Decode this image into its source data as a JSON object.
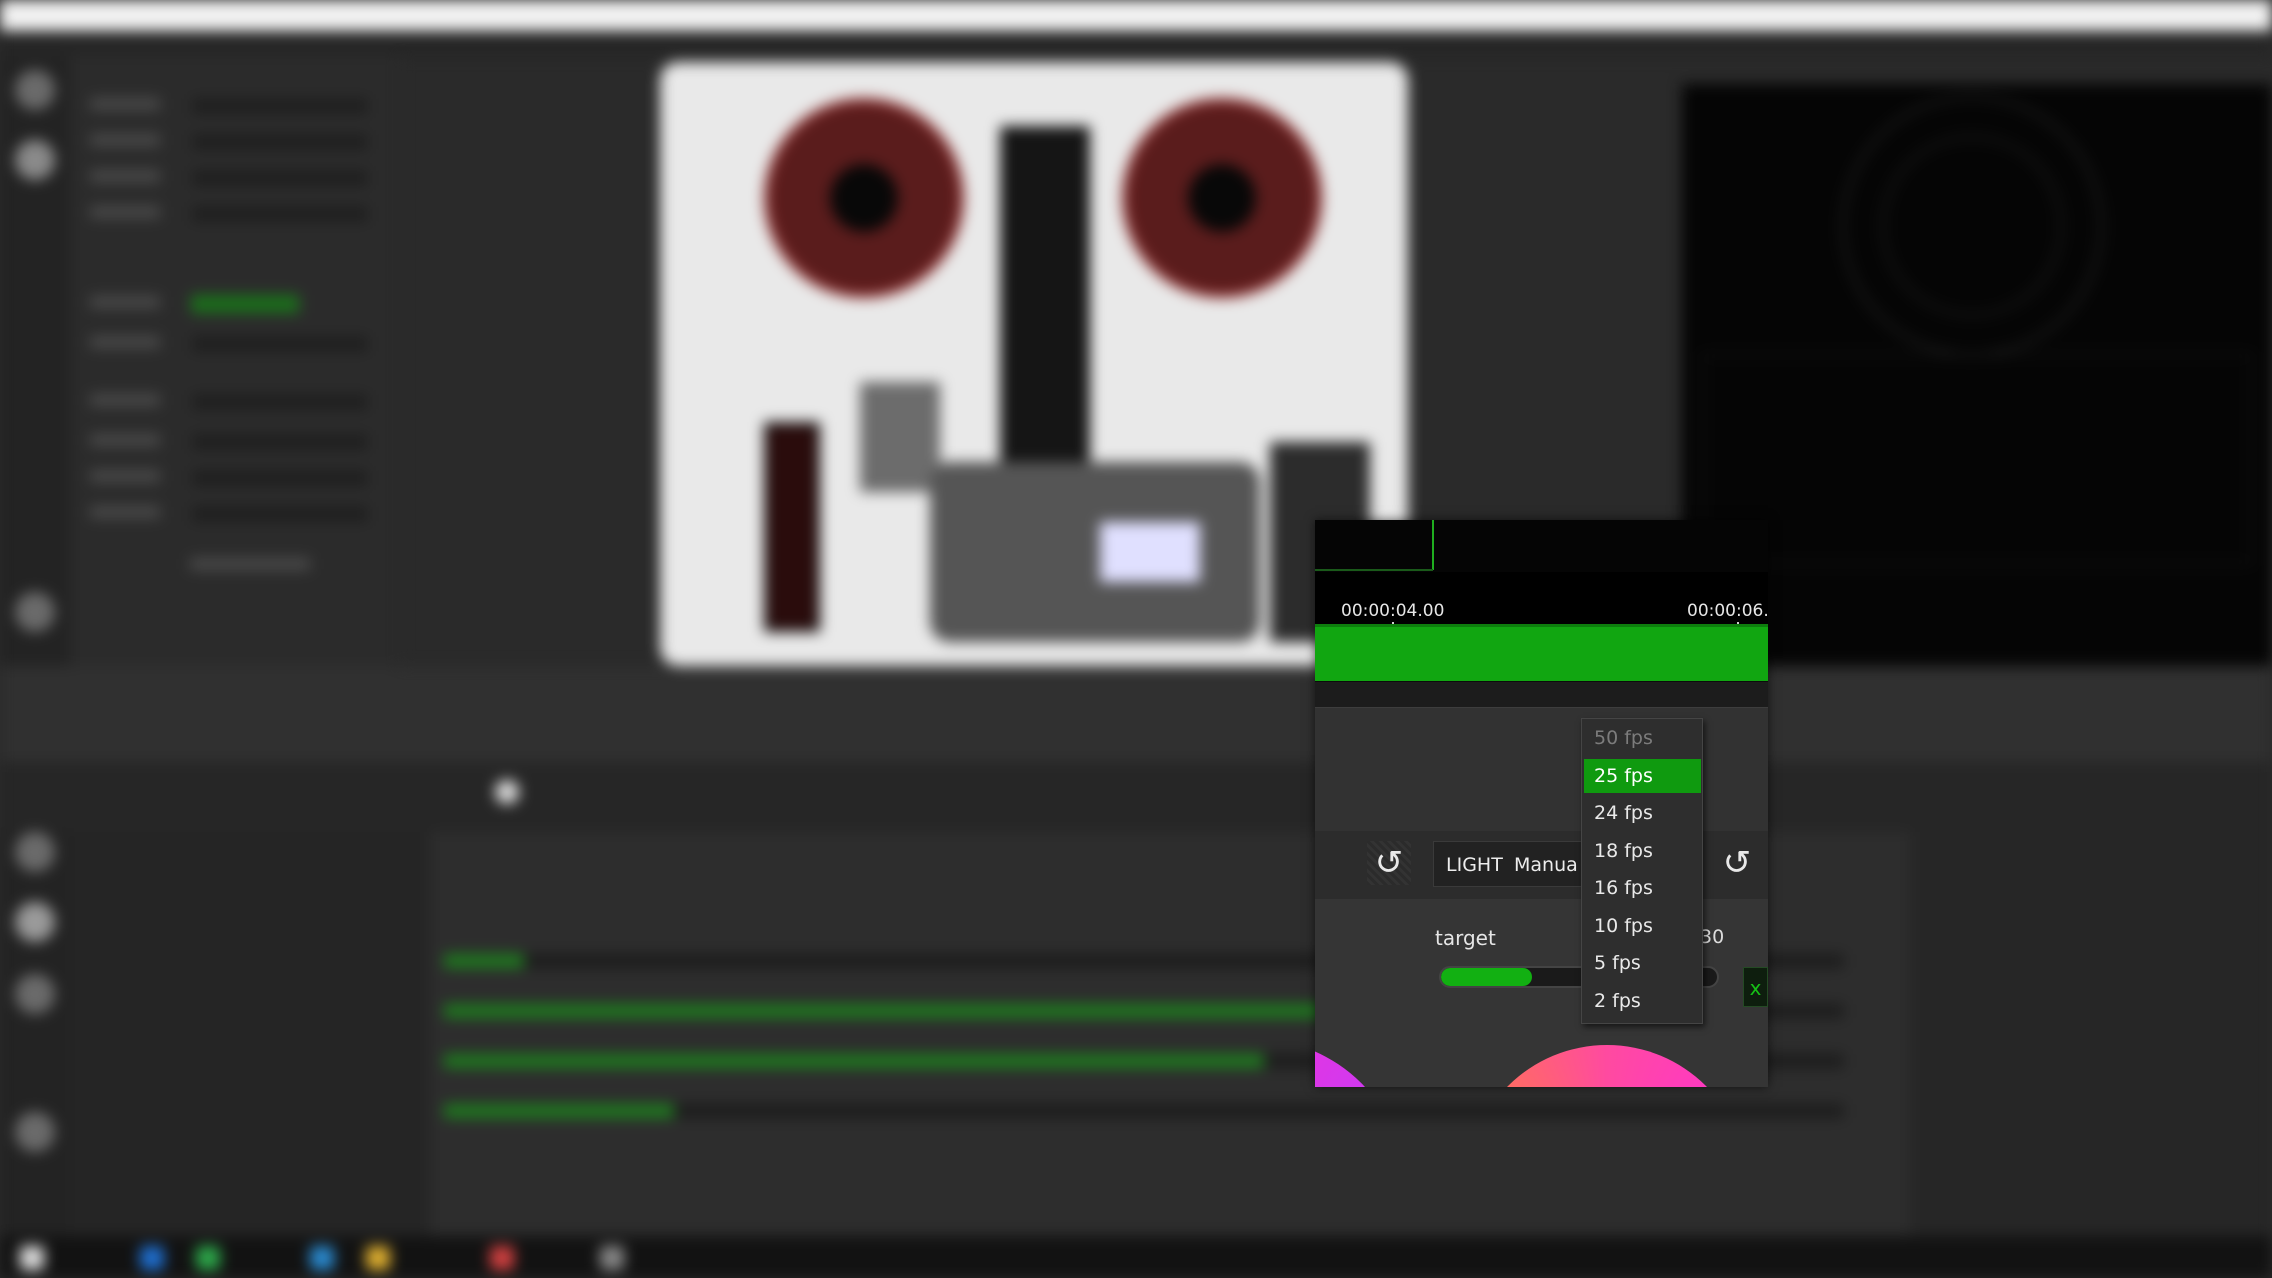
{
  "timeline": {
    "time_start": "00:00:04.00",
    "time_end": "00:00:06."
  },
  "toolbar": {
    "mode_label": "LIGHT",
    "mode_value": "Manua"
  },
  "target": {
    "label": "target",
    "value_partial": "30",
    "slider_level": 0.33,
    "close_label": "x"
  },
  "framerate_menu": {
    "options": [
      "50 fps",
      "25 fps",
      "24 fps",
      "18 fps",
      "16 fps",
      "10 fps",
      "5 fps",
      "2 fps"
    ],
    "selected": "25 fps",
    "disabled": "50 fps"
  },
  "colors": {
    "accent_green": "#11a611",
    "selection_green": "#0f9a0f",
    "panel_dark": "#303030"
  },
  "icons": [
    "undo-icon"
  ]
}
